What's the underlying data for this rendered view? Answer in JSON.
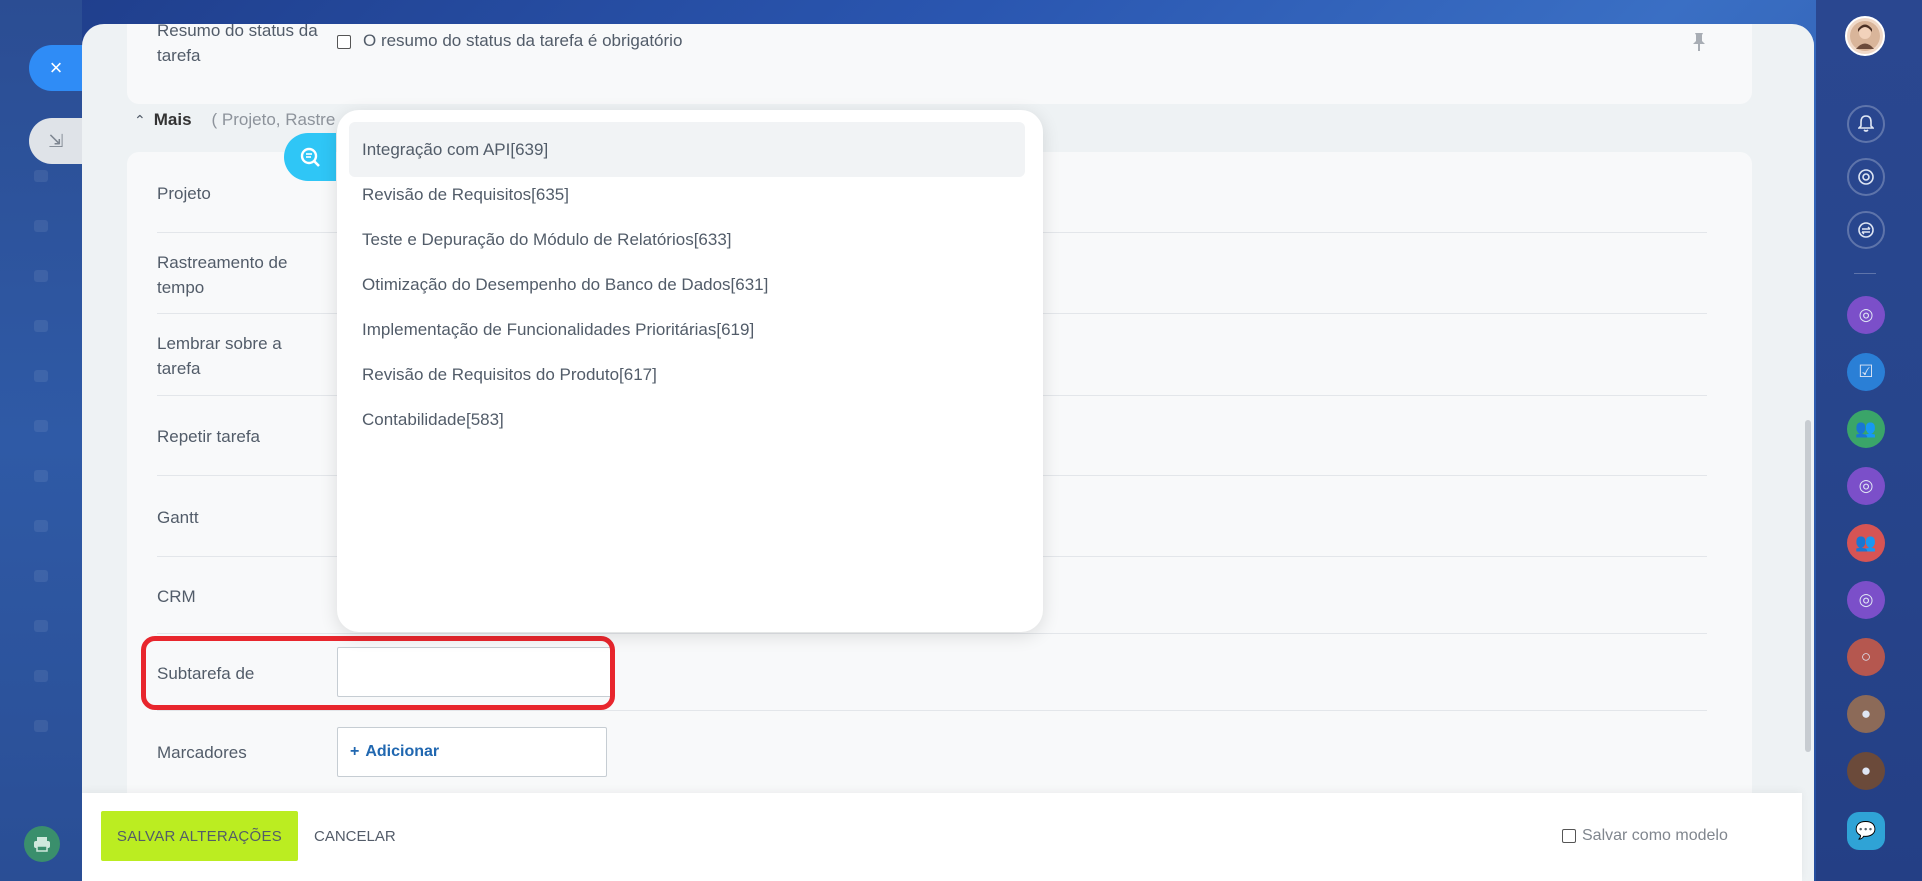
{
  "left": {
    "close_icon": "×",
    "collapse_icon": "⇲",
    "print_icon": "🖶"
  },
  "top_section": {
    "status_label": "Resumo do status da tarefa",
    "status_checkbox_label": "O resumo do status da tarefa é obrigatório",
    "pin_icon": "pin-icon"
  },
  "more": {
    "label": "Mais",
    "hint": "( Projeto,  Rastre"
  },
  "fields": {
    "projeto": "Projeto",
    "rastreamento": "Rastreamento de tempo",
    "lembrar": "Lembrar sobre a tarefa",
    "repetir": "Repetir tarefa",
    "gantt": "Gantt",
    "crm": "CRM",
    "subtarefa": "Subtarefa de",
    "marcadores": "Marcadores",
    "add_tag": "Adicionar"
  },
  "dropdown": {
    "items": [
      "Integração com API[639]",
      "Revisão de Requisitos[635]",
      "Teste e Depuração do Módulo de Relatórios[633]",
      "Otimização do Desempenho do Banco de Dados[631]",
      "Implementação de Funcionalidades Prioritárias[619]",
      "Revisão de Requisitos do Produto[617]",
      "Contabilidade[583]"
    ]
  },
  "footer": {
    "save": "SALVAR ALTERAÇÕES",
    "cancel": "CANCELAR",
    "save_template": "Salvar como modelo"
  },
  "colors": {
    "accent": "#2fc6f6",
    "save_button": "#bbed21",
    "highlight": "#e8262d"
  }
}
